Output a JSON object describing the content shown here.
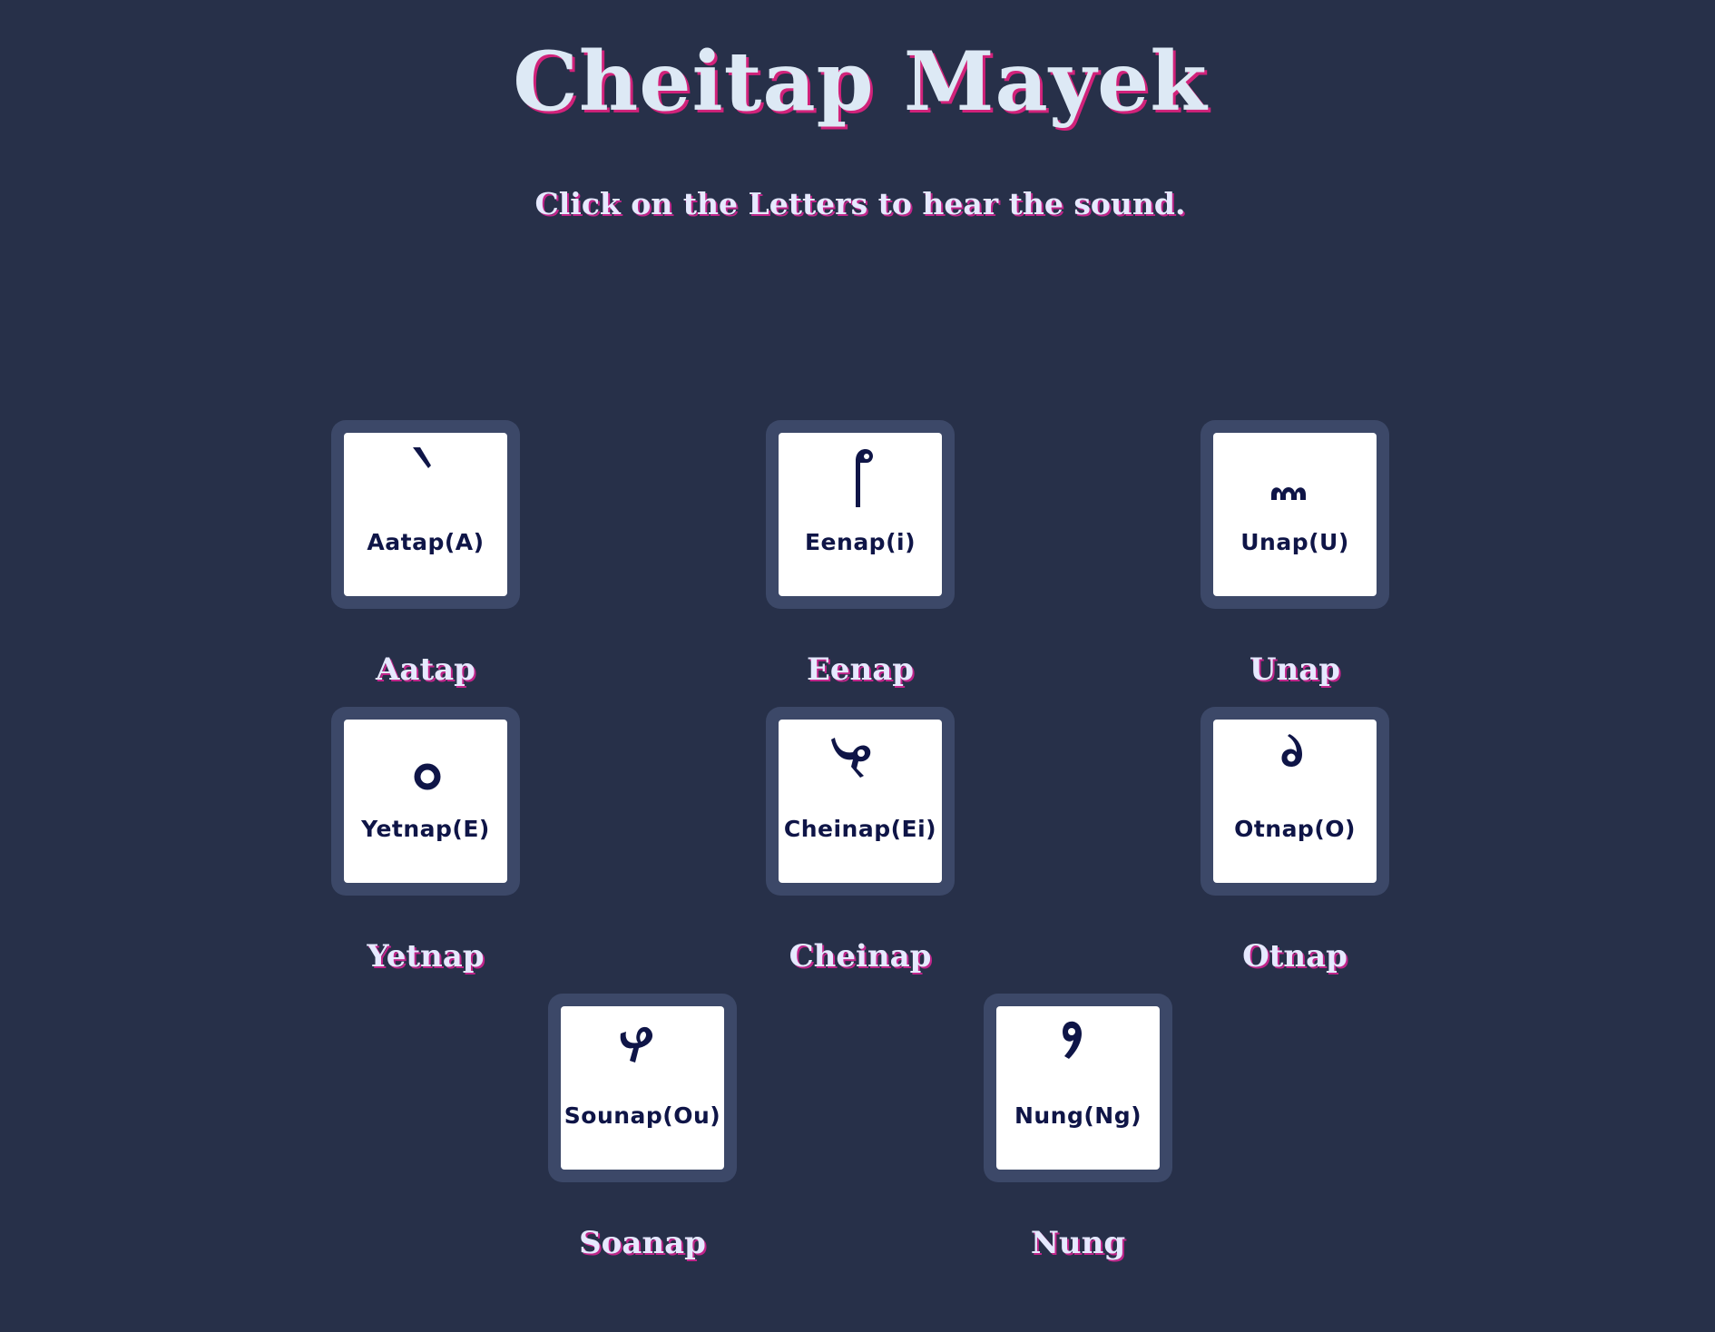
{
  "header": {
    "title": "Cheitap Mayek",
    "subtitle": "Click on the Letters to hear the sound."
  },
  "letters": [
    {
      "key_label": "Aatap(A)",
      "caption": "Aatap",
      "glyph_icon": "aatap-glyph"
    },
    {
      "key_label": "Eenap(i)",
      "caption": "Eenap",
      "glyph_icon": "eenap-glyph"
    },
    {
      "key_label": "Unap(U)",
      "caption": "Unap",
      "glyph_icon": "unap-glyph"
    },
    {
      "key_label": "Yetnap(E)",
      "caption": "Yetnap",
      "glyph_icon": "yetnap-glyph"
    },
    {
      "key_label": "Cheinap(Ei)",
      "caption": "Cheinap",
      "glyph_icon": "cheinap-glyph"
    },
    {
      "key_label": "Otnap(O)",
      "caption": "Otnap",
      "glyph_icon": "otnap-glyph"
    },
    {
      "key_label": "Sounap(Ou)",
      "caption": "Soanap",
      "glyph_icon": "sounap-glyph"
    },
    {
      "key_label": "Nung(Ng)",
      "caption": "Nung",
      "glyph_icon": "nung-glyph"
    }
  ],
  "colors": {
    "background": "#273049",
    "key_frame": "#3c4868",
    "key_face": "#ffffff",
    "glyph_ink": "#0f1547",
    "title_text": "#dde9f5",
    "title_shadow": "#d1227a"
  }
}
